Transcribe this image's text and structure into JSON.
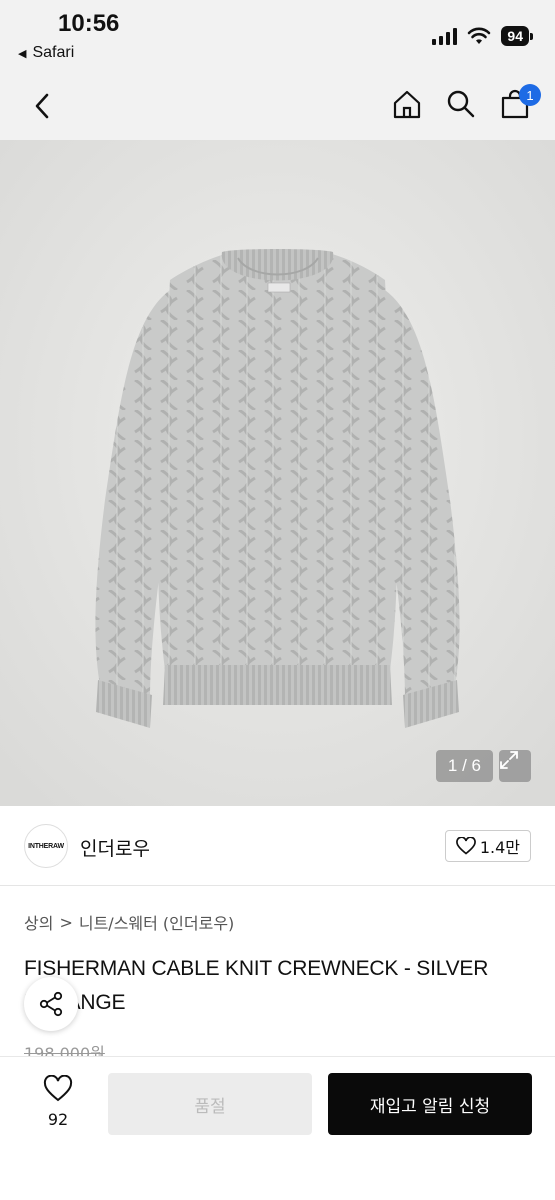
{
  "status_bar": {
    "time": "10:56",
    "back_app": "Safari",
    "battery": "94"
  },
  "nav": {
    "cart_count": "1"
  },
  "gallery": {
    "counter": "1 / 6"
  },
  "brand": {
    "logo_text": "INTHERAW",
    "name": "인더로우",
    "likes": "1.4만"
  },
  "breadcrumb": {
    "category": "상의",
    "separator": ">",
    "subcategory": "니트/스웨터 (인더로우)"
  },
  "product": {
    "title": "FISHERMAN CABLE KNIT CREWNECK - SILVER MELANGE",
    "price": "198,000원"
  },
  "bottom": {
    "wish_count": "92",
    "soldout_label": "품절",
    "restock_label": "재입고 알림 신청"
  },
  "colors": {
    "accent": "#1e6be5",
    "primary_button": "#0a0a0a",
    "disabled_button": "#ececec"
  }
}
